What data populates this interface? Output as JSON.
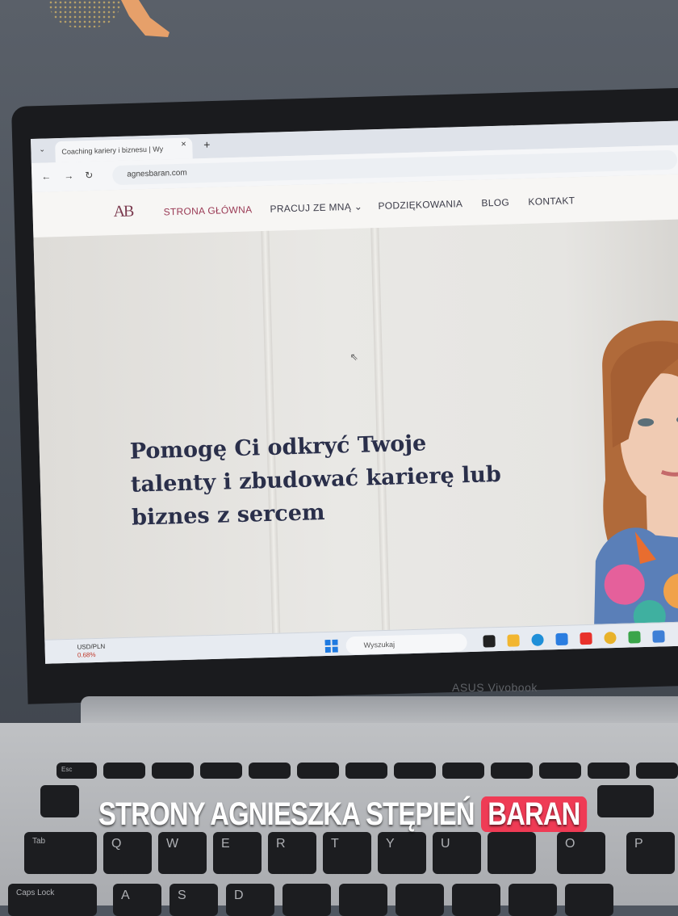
{
  "browser": {
    "tab_title": "Coaching kariery i biznesu | Wy",
    "tab_close": "×",
    "tab_new": "+",
    "url": "agnesbaran.com"
  },
  "site": {
    "logo": "AB",
    "menu": [
      "STRONA GŁÓWNA",
      "PRACUJ ZE MNĄ ⌄",
      "PODZIĘKOWANIA",
      "BLOG",
      "KONTAKT"
    ],
    "headline": "Pomogę Ci odkryć Twoje talenty i zbudować karierę lub biznes z sercem"
  },
  "taskbar": {
    "widget_label": "USD/PLN",
    "widget_change": "0.68%",
    "search_placeholder": "Wyszukaj"
  },
  "laptop": {
    "brand": "ASUS Vivobook",
    "keys": [
      "Esc",
      "Q",
      "W",
      "E",
      "R",
      "T",
      "Y",
      "U",
      "O",
      "P",
      "Tab",
      "Caps Lock",
      "A",
      "S",
      "D"
    ]
  },
  "caption": {
    "text": "STRONY AGNIESZKA STĘPIEŃ",
    "highlight": "BARAN"
  },
  "colors": {
    "accent": "#9a3a55",
    "headline": "#2a2f4a",
    "caption_highlight": "#ef3b55"
  }
}
